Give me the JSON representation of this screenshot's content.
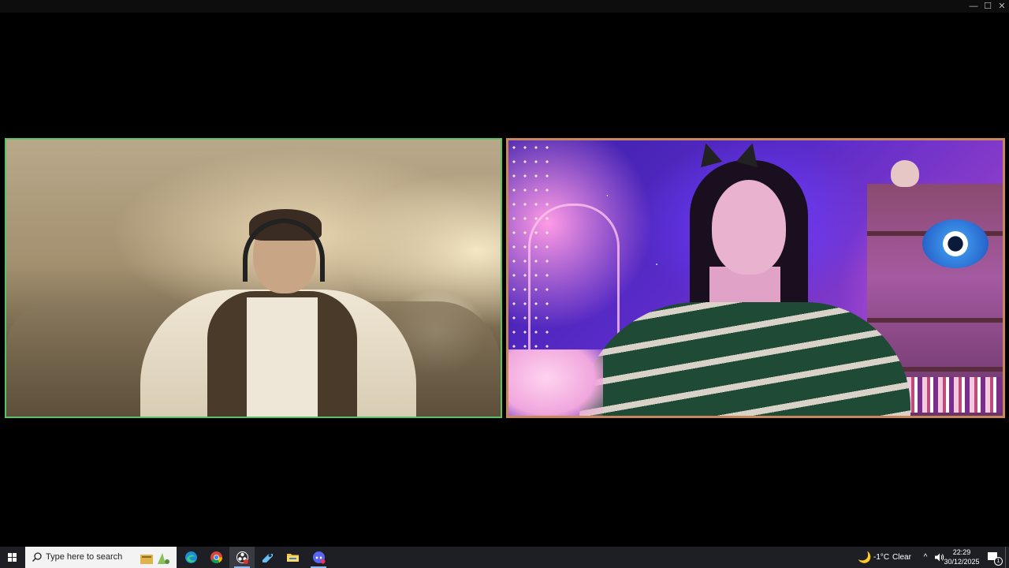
{
  "window": {
    "controls": {
      "minimize": "—",
      "maximize": "☐",
      "close": "✕"
    }
  },
  "video_tiles": [
    {
      "position": "left",
      "border_color": "#5fc06a"
    },
    {
      "position": "right",
      "border_color": "#c6885c"
    }
  ],
  "taskbar": {
    "search_placeholder": "Type here to search",
    "pinned_apps": [
      {
        "icon": "edge-icon"
      },
      {
        "icon": "chrome-icon"
      },
      {
        "icon": "obs-icon",
        "active": true
      },
      {
        "icon": "steam-icon"
      },
      {
        "icon": "file-explorer-icon"
      },
      {
        "icon": "discord-icon"
      }
    ],
    "weather": {
      "icon": "moon-icon",
      "temperature": "-1°C",
      "condition": "Clear"
    },
    "clock": {
      "time": "22:29",
      "date": "30/12/2025"
    },
    "notifications": {
      "count": "1"
    },
    "chevron": "^"
  },
  "colors": {
    "taskbar_bg": "#1e1f25",
    "left_border": "#5fc06a",
    "right_border": "#c6885c",
    "accent_underline": "#8fb8f0"
  }
}
